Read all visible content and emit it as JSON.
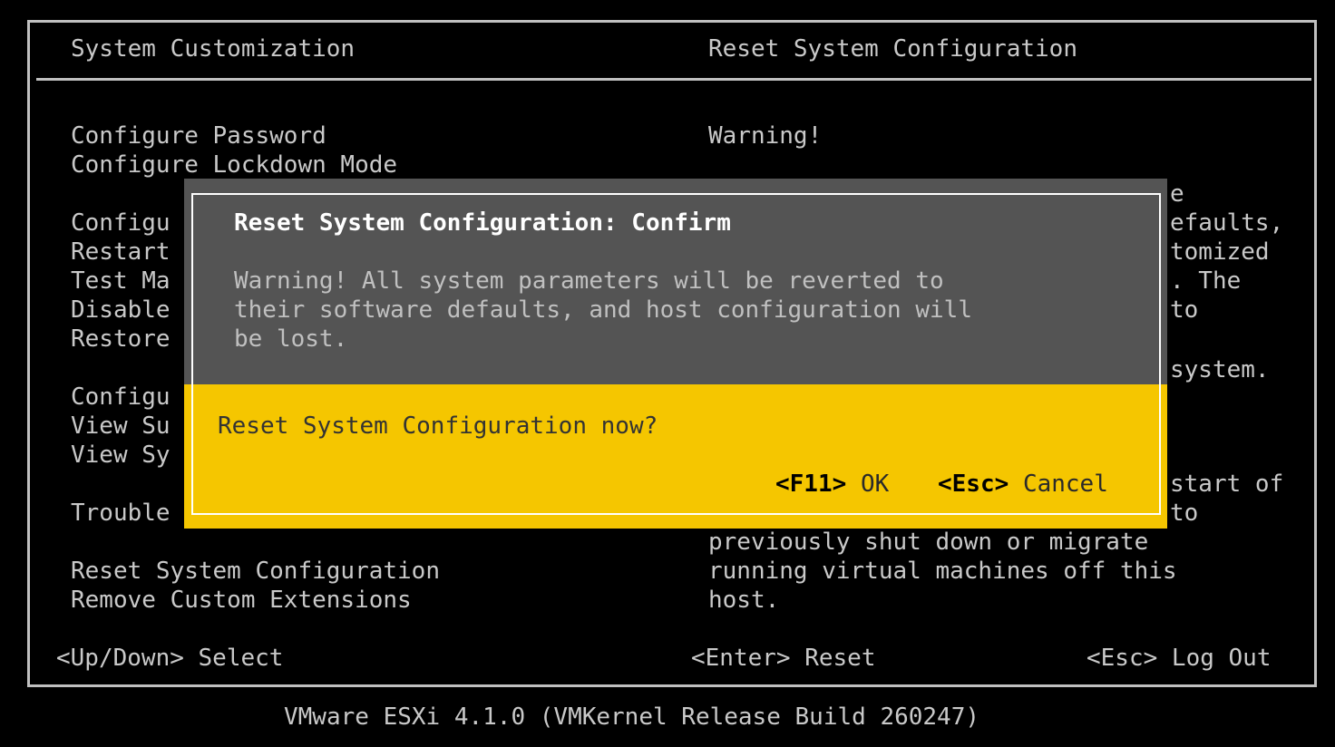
{
  "left_panel": {
    "title": "System Customization",
    "menu_items": [
      "Configure Password",
      "Configure Lockdown Mode",
      "Configu",
      "Restart",
      "Test Ma",
      "Disable",
      "Restore",
      "Configu",
      "View Su",
      "View Sy",
      "Trouble",
      "Reset System Configuration",
      "Remove Custom Extensions"
    ]
  },
  "right_panel": {
    "title": "Reset System Configuration",
    "warning_heading": "Warning!",
    "fragments": [
      "e",
      "efaults,",
      "tomized",
      ". The",
      "to",
      "system.",
      "start of",
      "to"
    ],
    "lines_bottom": [
      "previously shut down or migrate",
      "running virtual machines off this",
      "host."
    ]
  },
  "footer_keys": {
    "select": "<Up/Down> Select",
    "reset": "<Enter> Reset",
    "logout": "<Esc> Log Out"
  },
  "dialog": {
    "title": "Reset System Configuration: Confirm",
    "body_lines": [
      "Warning! All system parameters will be reverted to",
      "their software defaults, and host configuration will",
      "be lost."
    ],
    "question": "Reset System Configuration now?",
    "ok_key": "<F11>",
    "ok_label": "OK",
    "cancel_key": "<Esc>",
    "cancel_label": "Cancel"
  },
  "status_bar": "VMware ESXi 4.1.0 (VMKernel Release Build 260247)"
}
